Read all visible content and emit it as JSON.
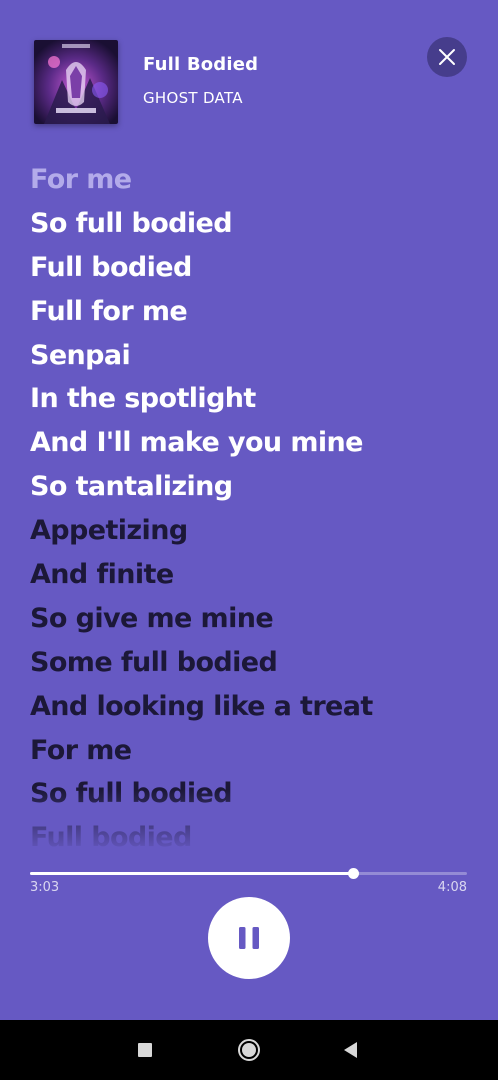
{
  "app": {
    "background_color": "#6659c3"
  },
  "now_playing": {
    "title": "Full Bodied",
    "artist": "GHOST DATA",
    "album_art_icon": "album-cover",
    "close_icon": "close-icon"
  },
  "lyrics": {
    "lines": [
      {
        "text": "For me",
        "state": "past"
      },
      {
        "text": "So full bodied",
        "state": "active"
      },
      {
        "text": "Full bodied",
        "state": "active"
      },
      {
        "text": "Full for me",
        "state": "active"
      },
      {
        "text": "Senpai",
        "state": "active"
      },
      {
        "text": "In the spotlight",
        "state": "active"
      },
      {
        "text": "And I'll make you mine",
        "state": "active"
      },
      {
        "text": "So tantalizing",
        "state": "active"
      },
      {
        "text": "Appetizing",
        "state": "upcoming"
      },
      {
        "text": "And finite",
        "state": "upcoming"
      },
      {
        "text": "So give me mine",
        "state": "upcoming"
      },
      {
        "text": "Some full bodied",
        "state": "upcoming"
      },
      {
        "text": "And looking like a treat",
        "state": "upcoming"
      },
      {
        "text": "For me",
        "state": "upcoming"
      },
      {
        "text": "So full bodied",
        "state": "upcoming"
      },
      {
        "text": "Full bodied",
        "state": "upcoming"
      }
    ],
    "colors": {
      "past": "#b3abea",
      "active": "#ffffff",
      "upcoming": "#1c1838"
    }
  },
  "playback": {
    "elapsed": "3:03",
    "total": "4:08",
    "progress_fraction": 0.738,
    "pause_icon": "pause-icon"
  },
  "system_nav": {
    "recents_icon": "square-icon",
    "home_icon": "circle-icon",
    "back_icon": "triangle-back-icon"
  }
}
